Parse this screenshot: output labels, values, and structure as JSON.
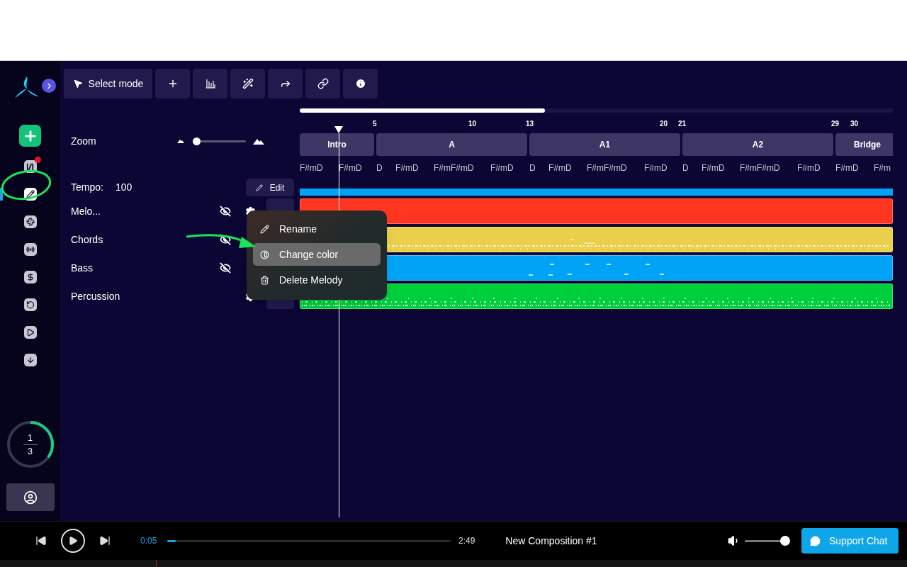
{
  "sidebar": {
    "items": [
      {
        "selected": false,
        "badge": true
      },
      {
        "selected": true,
        "badge": false
      },
      {
        "selected": false,
        "badge": false
      },
      {
        "selected": false,
        "badge": false
      },
      {
        "selected": false,
        "badge": false
      },
      {
        "selected": false,
        "badge": false
      },
      {
        "selected": false,
        "badge": false
      },
      {
        "selected": false,
        "badge": false
      }
    ],
    "progress": {
      "done": "1",
      "total": "3",
      "level": 0.35
    }
  },
  "toolbar": {
    "select_mode": "Select mode"
  },
  "zoom": {
    "label": "Zoom",
    "level": 0.0
  },
  "tempo": {
    "label": "Tempo:",
    "value": "100",
    "edit": "Edit"
  },
  "tracks": [
    {
      "name": "Melo...",
      "hidden": true,
      "color": "#ff3520",
      "kind": "empty"
    },
    {
      "name": "Chords",
      "hidden": true,
      "color": "#e9cf4a",
      "kind": "dense"
    },
    {
      "name": "Bass",
      "hidden": true,
      "color": "#00a3f5",
      "kind": "sparse"
    },
    {
      "name": "Percussion",
      "hidden": false,
      "color": "#00cf3c",
      "kind": "drums"
    }
  ],
  "timeline": {
    "bars": [
      "5",
      "10",
      "13",
      "20",
      "21",
      "29",
      "30"
    ],
    "sections": [
      {
        "label": "Intro"
      },
      {
        "label": "A"
      },
      {
        "label": "A1"
      },
      {
        "label": "A2"
      },
      {
        "label": "Bridge"
      }
    ],
    "chords": [
      "F#mD",
      "F#mD",
      "D",
      "F#mD",
      "F#mF#mD",
      "F#mD",
      "D",
      "F#mD",
      "F#mF#mD",
      "F#mD",
      "D",
      "F#mD",
      "F#mF#mD",
      "F#mD",
      "F#mD",
      "F#m"
    ]
  },
  "context_menu": [
    {
      "label": "Rename",
      "selected": false
    },
    {
      "label": "Change color",
      "selected": true
    },
    {
      "label": "Delete Melody",
      "selected": false
    }
  ],
  "player": {
    "elapsed": "0:05",
    "total": "2:49",
    "level": 0.03,
    "title": "New Composition #1",
    "volume": {
      "level": 1.0
    },
    "support": "Support Chat"
  }
}
